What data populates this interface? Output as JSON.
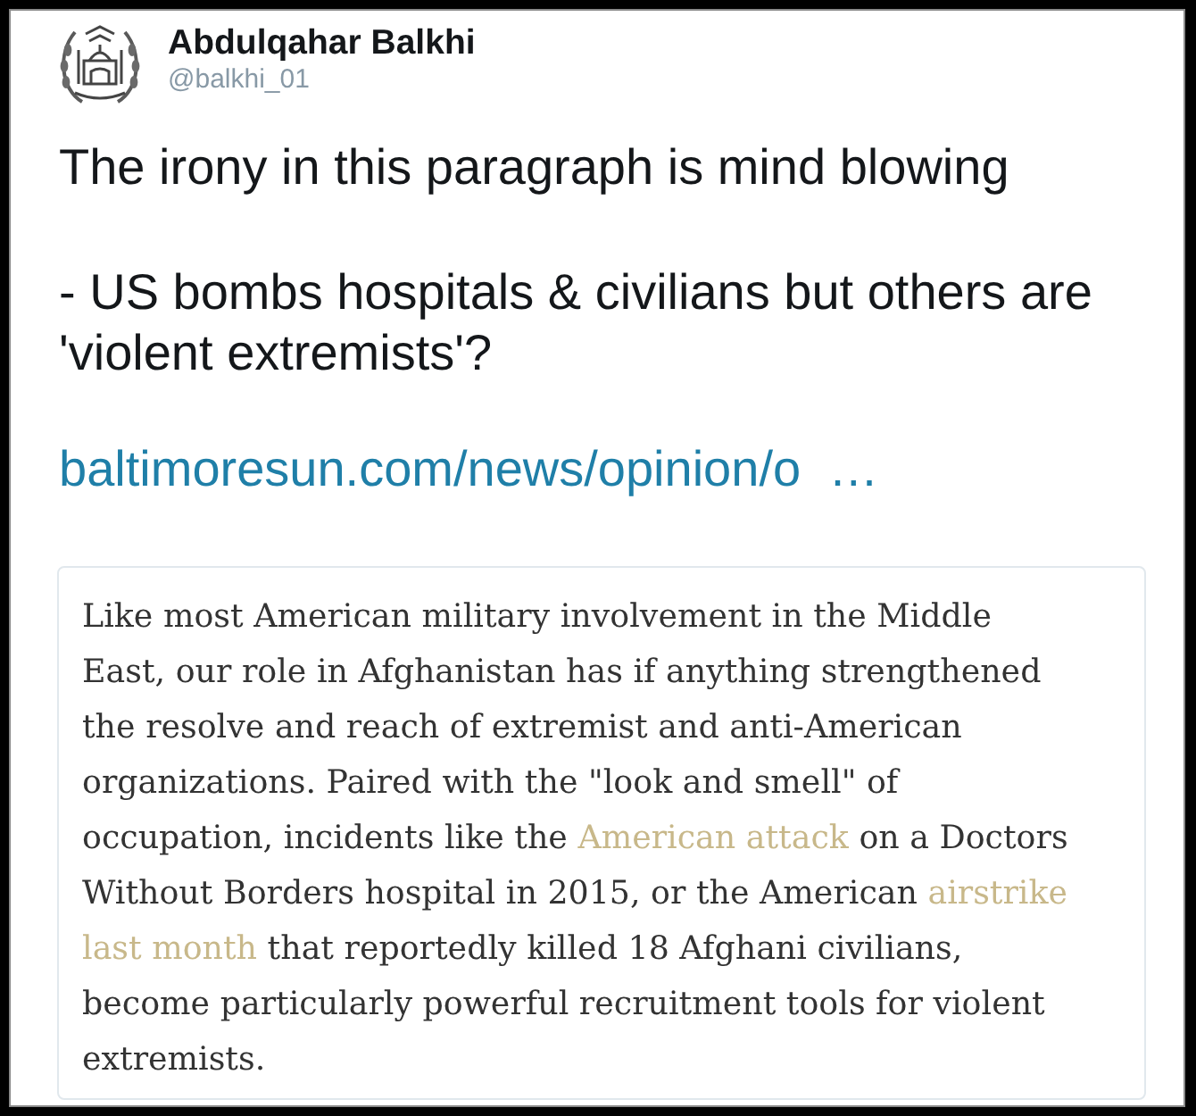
{
  "profile": {
    "name": "Abdulqahar Balkhi",
    "handle": "@balkhi_01"
  },
  "tweet": {
    "paragraphs": [
      "The irony in this paragraph is mind blowing",
      "- US bombs hospitals & civilians but others are 'violent extremists'?"
    ],
    "link": "baltimoresun.com/news/opinion/o  …"
  },
  "quote_card": {
    "segments": [
      {
        "kind": "text",
        "text": "Like most American military involvement in the Middle East, our role in Afghanistan has if anything strengthened the resolve and reach of extremist and anti-American organizations. Paired with the \"look and smell\" of occupation, incidents like the "
      },
      {
        "kind": "link",
        "parts": [
          "American attack"
        ]
      },
      {
        "kind": "text",
        "text": " on a Doctors Without Borders hospital in 2015, or the American "
      },
      {
        "kind": "link",
        "parts": [
          "airstrike",
          "last month"
        ]
      },
      {
        "kind": "text",
        "text": " that reportedly killed 18 Afghani civilians, become particularly powerful recruitment tools for violent extremists."
      }
    ]
  }
}
